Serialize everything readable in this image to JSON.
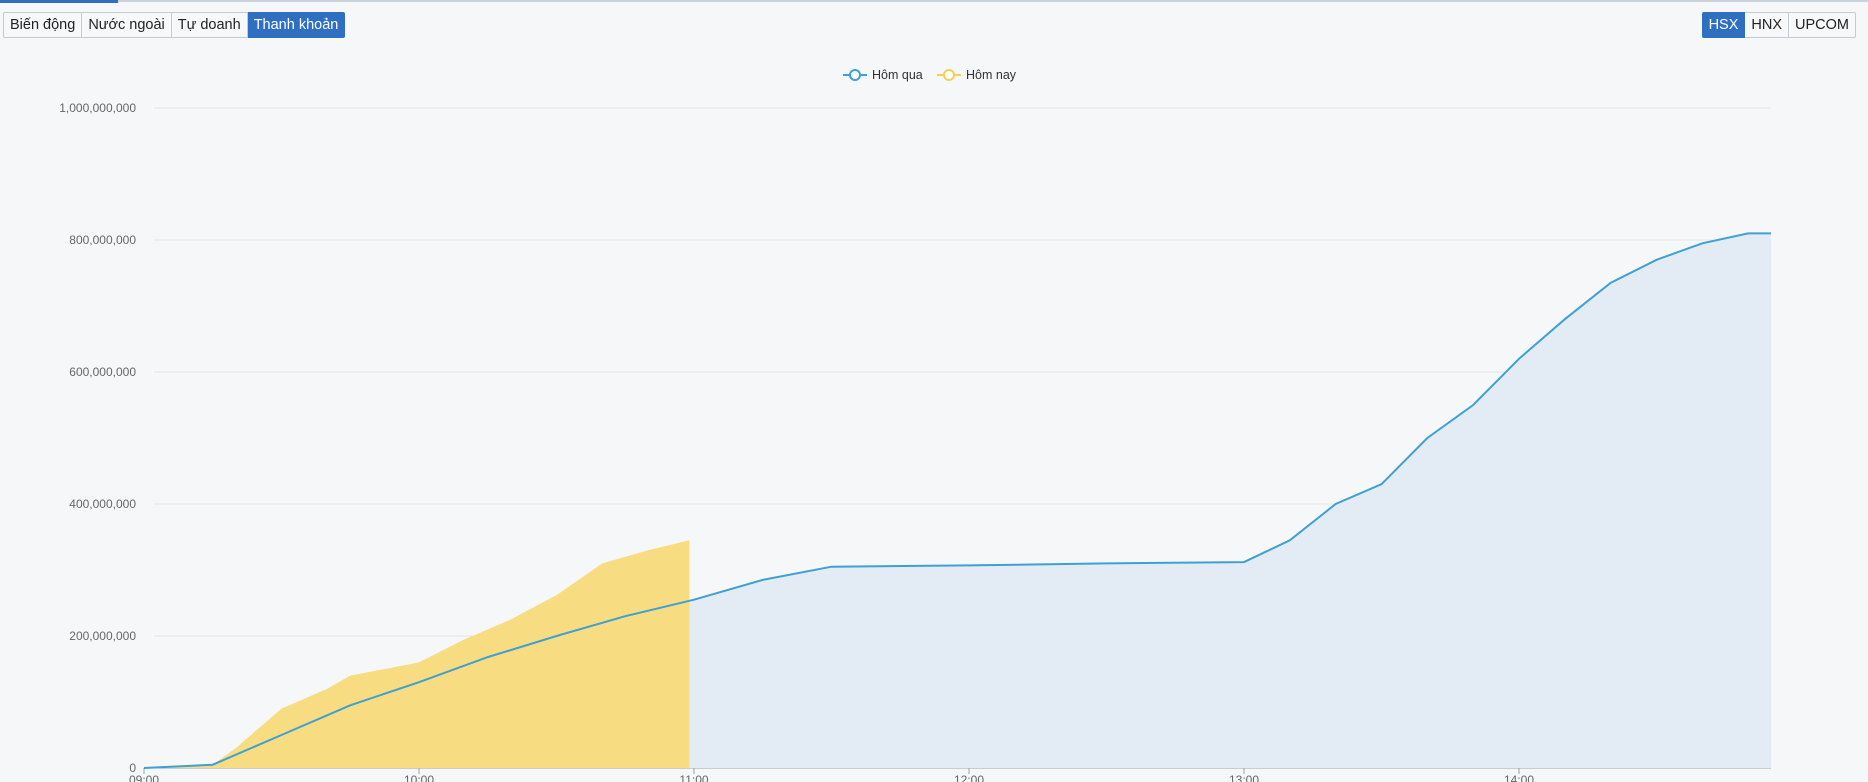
{
  "tabs": {
    "items": [
      {
        "label": "Biến động"
      },
      {
        "label": "Nước ngoài"
      },
      {
        "label": "Tự doanh"
      },
      {
        "label": "Thanh khoản"
      }
    ],
    "active": "Thanh khoản"
  },
  "exchanges": {
    "items": [
      {
        "label": "HSX"
      },
      {
        "label": "HNX"
      },
      {
        "label": "UPCOM"
      }
    ],
    "active": "HSX"
  },
  "colors": {
    "accent": "#2e6fc2",
    "yesterday_line": "#3ea0d3",
    "yesterday_area": "#e3ecf5",
    "today_area": "#f7dc82",
    "today_line": "#f5cf55"
  },
  "chart_data": {
    "type": "area",
    "title": "",
    "xlabel": "",
    "ylabel": "",
    "ylim": [
      0,
      1000000000
    ],
    "xlim": [
      "09:00",
      "14:55"
    ],
    "grid": true,
    "legend_position": "top-center",
    "y_ticks": [
      "0",
      "200,000,000",
      "400,000,000",
      "600,000,000",
      "800,000,000",
      "1,000,000,000"
    ],
    "x_ticks": [
      "09:00",
      "10:00",
      "11:00",
      "12:00",
      "13:00",
      "14:00"
    ],
    "series": [
      {
        "name": "Hôm qua",
        "color": "#3ea0d3",
        "x": [
          "09:00",
          "09:15",
          "09:30",
          "09:45",
          "10:00",
          "10:15",
          "10:30",
          "10:45",
          "11:00",
          "11:15",
          "11:30",
          "12:00",
          "12:30",
          "13:00",
          "13:10",
          "13:20",
          "13:30",
          "13:40",
          "13:50",
          "14:00",
          "14:10",
          "14:20",
          "14:30",
          "14:40",
          "14:50",
          "14:55"
        ],
        "values": [
          0,
          5000000,
          50000000,
          95000000,
          130000000,
          168000000,
          200000000,
          230000000,
          255000000,
          285000000,
          305000000,
          307000000,
          310000000,
          312000000,
          345000000,
          400000000,
          430000000,
          500000000,
          550000000,
          620000000,
          680000000,
          735000000,
          770000000,
          795000000,
          810000000,
          810000000
        ]
      },
      {
        "name": "Hôm nay",
        "color": "#f5cf55",
        "x": [
          "09:00",
          "09:15",
          "09:20",
          "09:30",
          "09:40",
          "09:45",
          "10:00",
          "10:10",
          "10:20",
          "10:30",
          "10:40",
          "10:50",
          "10:59"
        ],
        "values": [
          0,
          5000000,
          30000000,
          90000000,
          120000000,
          140000000,
          160000000,
          195000000,
          225000000,
          262000000,
          310000000,
          330000000,
          345000000
        ]
      }
    ]
  }
}
